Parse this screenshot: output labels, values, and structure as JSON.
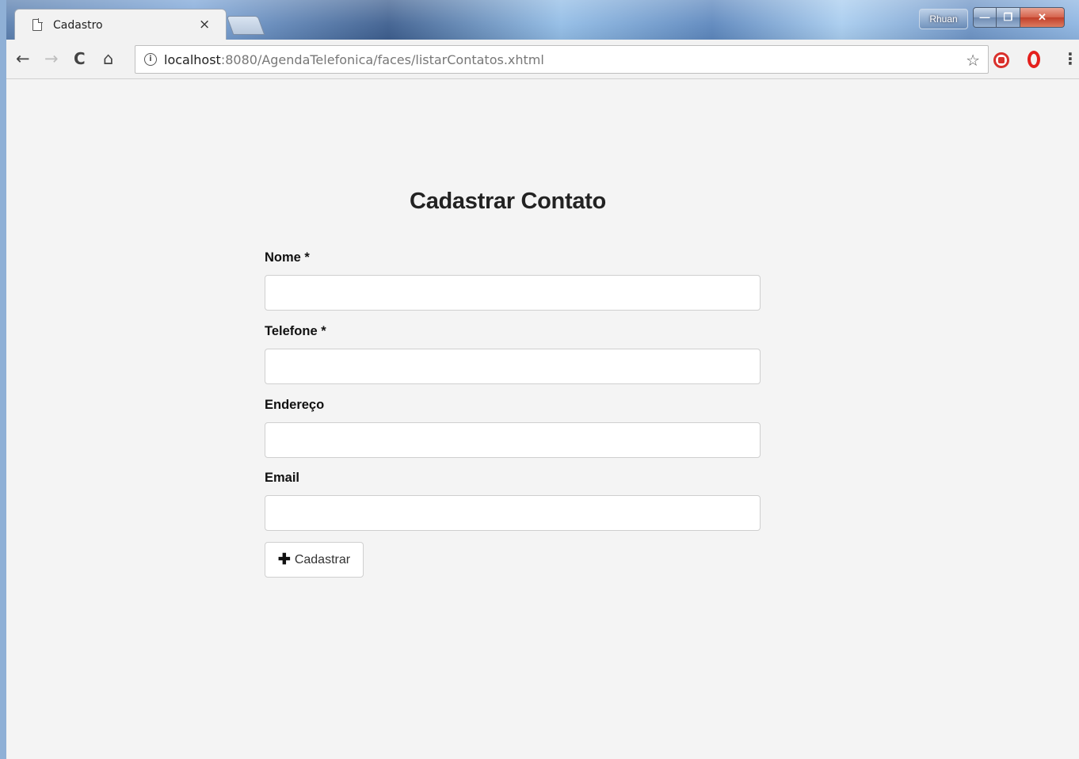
{
  "browser": {
    "tab_title": "Cadastro",
    "tab_close_icon": "×",
    "user_name": "Rhuan",
    "url_host": "localhost",
    "url_rest": ":8080/AgendaTelefonica/faces/listarContatos.xhtml",
    "icons": {
      "back": "←",
      "forward": "→",
      "reload": "C",
      "home": "⌂",
      "info": "i",
      "star": "☆",
      "menu": "⋮"
    }
  },
  "form": {
    "title": "Cadastrar Contato",
    "fields": [
      {
        "label": "Nome *",
        "value": ""
      },
      {
        "label": "Telefone *",
        "value": ""
      },
      {
        "label": "Endereço",
        "value": ""
      },
      {
        "label": "Email",
        "value": ""
      }
    ],
    "submit": {
      "icon": "✚",
      "label": "Cadastrar"
    }
  }
}
